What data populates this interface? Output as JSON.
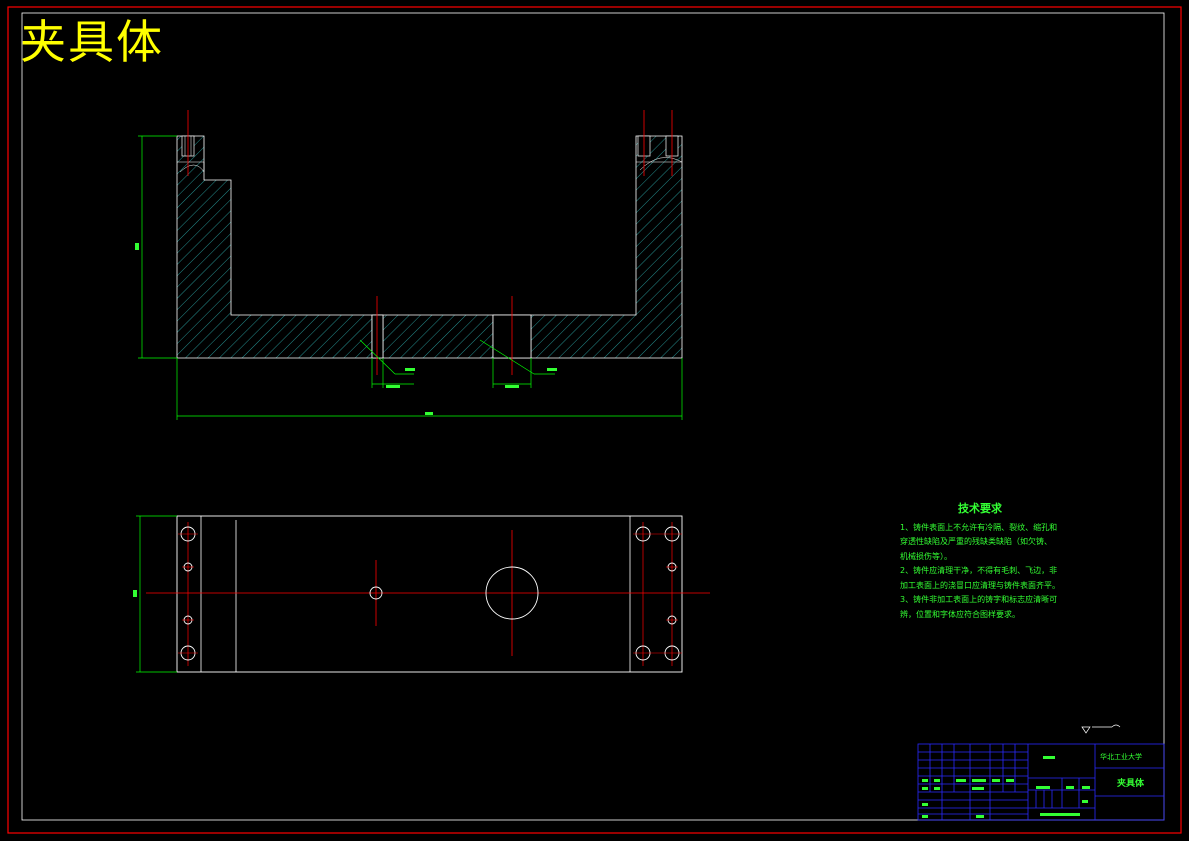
{
  "drawing_title": "夹具体",
  "tech_requirements": {
    "title": "技术要求",
    "lines": [
      "1、铸件表面上不允许有冷隔、裂纹、缩孔和",
      "穿透性缺陷及严重的残缺类缺陷（如欠铸、",
      "机械损伤等）。",
      "2、铸件应清理干净，不得有毛刺、飞边，非",
      "加工表面上的浇冒口应清理与铸件表面齐平。",
      "3、铸件非加工表面上的铸字和标志应清晰可",
      "辨，位置和字体应符合图样要求。"
    ]
  },
  "title_block": {
    "part_name": "夹具体",
    "school": "华北工业大学"
  },
  "colors": {
    "background": "#000000",
    "outer_frame": "#ff0000",
    "inner_frame": "#ffffff",
    "title_text": "#ffff00",
    "hatch": "#33cccc",
    "centerline": "#ff0000",
    "dimension": "#00ff00",
    "annotation_text": "#33ff33",
    "title_block_lines": "#0000ff"
  }
}
